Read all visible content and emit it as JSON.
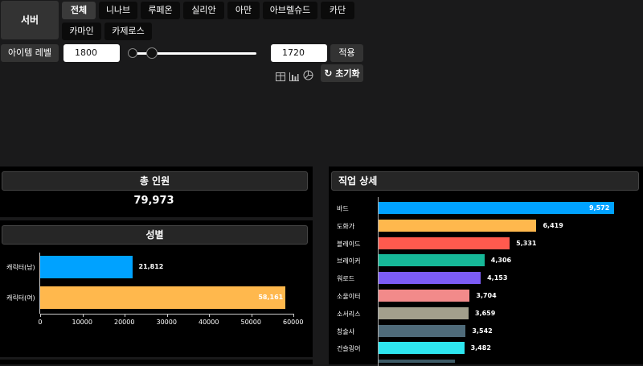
{
  "filters": {
    "server_label": "서버",
    "servers": [
      "전체",
      "니나브",
      "루페온",
      "실리안",
      "아만",
      "아브렐슈드",
      "카단",
      "카마인",
      "카제로스"
    ],
    "level_label": "아이템 레벨",
    "level_min": "1800",
    "level_max": "1720",
    "apply_label": "적용",
    "reset_label": "초기화",
    "view_icons": [
      "table-icon",
      "bar-chart-icon",
      "pie-chart-icon"
    ]
  },
  "total": {
    "title": "총 인원",
    "value": "79,973"
  },
  "gender": {
    "title": "성별",
    "chart_data": {
      "type": "bar",
      "orientation": "horizontal",
      "categories": [
        "캐릭터(남)",
        "캐릭터(여)"
      ],
      "values": [
        21812,
        58161
      ],
      "value_labels": [
        "21,812",
        "58,161"
      ],
      "colors": [
        "#00a2ff",
        "#ffb84d"
      ],
      "xlim": [
        0,
        60000
      ],
      "xticks": [
        "0",
        "10000",
        "20000",
        "30000",
        "40000",
        "50000",
        "60000"
      ]
    }
  },
  "jobs": {
    "title": "직업 상세",
    "chart_data": {
      "type": "bar",
      "orientation": "horizontal",
      "categories": [
        "바드",
        "도화가",
        "블레이드",
        "브레이커",
        "워로드",
        "소울이터",
        "소서리스",
        "창술사",
        "건슬링어"
      ],
      "values": [
        9572,
        6419,
        5331,
        4306,
        4153,
        3704,
        3659,
        3542,
        3482
      ],
      "value_labels": [
        "9,572",
        "6,419",
        "5,331",
        "4,306",
        "4,153",
        "3,704",
        "3,659",
        "3,542",
        "3,482"
      ],
      "colors": [
        "#00a2ff",
        "#ffb84d",
        "#ff5a4e",
        "#16b898",
        "#7c5cf5",
        "#f28a8a",
        "#a39f8c",
        "#4f6b7a",
        "#2ee6f0"
      ]
    }
  }
}
